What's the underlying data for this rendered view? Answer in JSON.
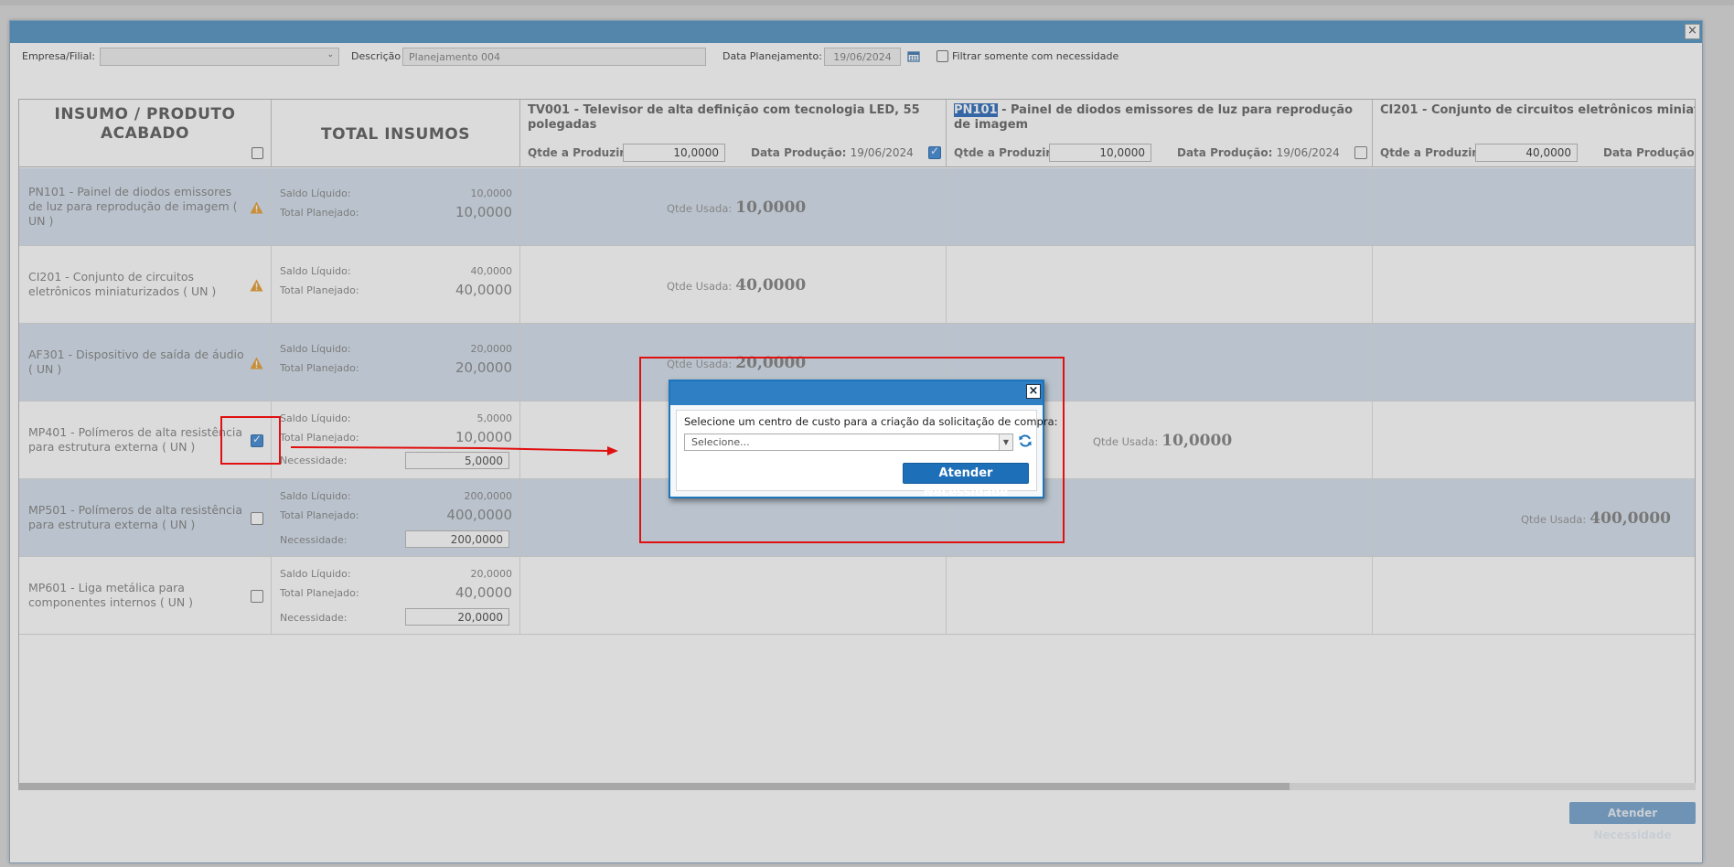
{
  "filters": {
    "empresa_label": "Empresa/Filial:",
    "empresa_value": "",
    "descricao_label": "Descrição",
    "descricao_value": "Planejamento 004",
    "data_label": "Data Planejamento:",
    "data_value": "19/06/2024",
    "filtrar_label": "Filtrar somente com necessidade"
  },
  "headers": {
    "insumo": "INSUMO / PRODUTO ACABADO",
    "total": "TOTAL INSUMOS",
    "qtde_label": "Qtde a Produzir:",
    "data_prod_label": "Data Produção:"
  },
  "products": [
    {
      "code": "TV001",
      "title": " - Televisor de alta definição com tecnologia LED, 55 polegadas",
      "qtde": "10,0000",
      "date": "19/06/2024",
      "checked": true
    },
    {
      "code": "PN101",
      "title": " - Painel de diodos emissores de luz para reprodução de imagem",
      "qtde": "10,0000",
      "date": "19/06/2024",
      "checked": false
    },
    {
      "code": "CI201",
      "title": " - Conjunto de circuitos eletrônicos miniaturizados",
      "qtde": "40,0000",
      "date": "",
      "checked": false
    }
  ],
  "labels": {
    "saldo": "Saldo Líquido:",
    "planejado": "Total Planejado:",
    "necessidade": "Necessidade:",
    "usada": "Qtde Usada:"
  },
  "rows": [
    {
      "insumo": "PN101 - Painel de diodos emissores de luz para reprodução de imagem ( UN )",
      "saldo": "10,0000",
      "planejado": "10,0000",
      "necessidade": "",
      "usada": "10,0000"
    },
    {
      "insumo": "CI201 - Conjunto de circuitos eletrônicos miniaturizados ( UN )",
      "saldo": "40,0000",
      "planejado": "40,0000",
      "necessidade": "",
      "usada": "40,0000"
    },
    {
      "insumo": "AF301 - Dispositivo de saída de áudio ( UN )",
      "saldo": "20,0000",
      "planejado": "20,0000",
      "necessidade": "",
      "usada": "20,0000"
    },
    {
      "insumo": "MP401 - Polímeros de alta resistência para estrutura externa ( UN )",
      "saldo": "5,0000",
      "planejado": "10,0000",
      "necessidade": "5,0000",
      "usada": "10,0000"
    },
    {
      "insumo": "MP501 - Polímeros de alta resistência para estrutura externa ( UN )",
      "saldo": "200,0000",
      "planejado": "400,0000",
      "necessidade": "200,0000",
      "usada": "400,0000"
    },
    {
      "insumo": "MP601 - Liga metálica para componentes internos ( UN )",
      "saldo": "20,0000",
      "planejado": "40,0000",
      "necessidade": "20,0000",
      "usada": ""
    }
  ],
  "bottom_button": "Atender Necessidade",
  "dialog": {
    "message": "Selecione um centro de custo para a criação da solicitação de compra:",
    "select_placeholder": "Selecione...",
    "button": "Atender Necessidade"
  },
  "colors": {
    "accent": "#2e7fc3",
    "annotation": "#e01010"
  }
}
